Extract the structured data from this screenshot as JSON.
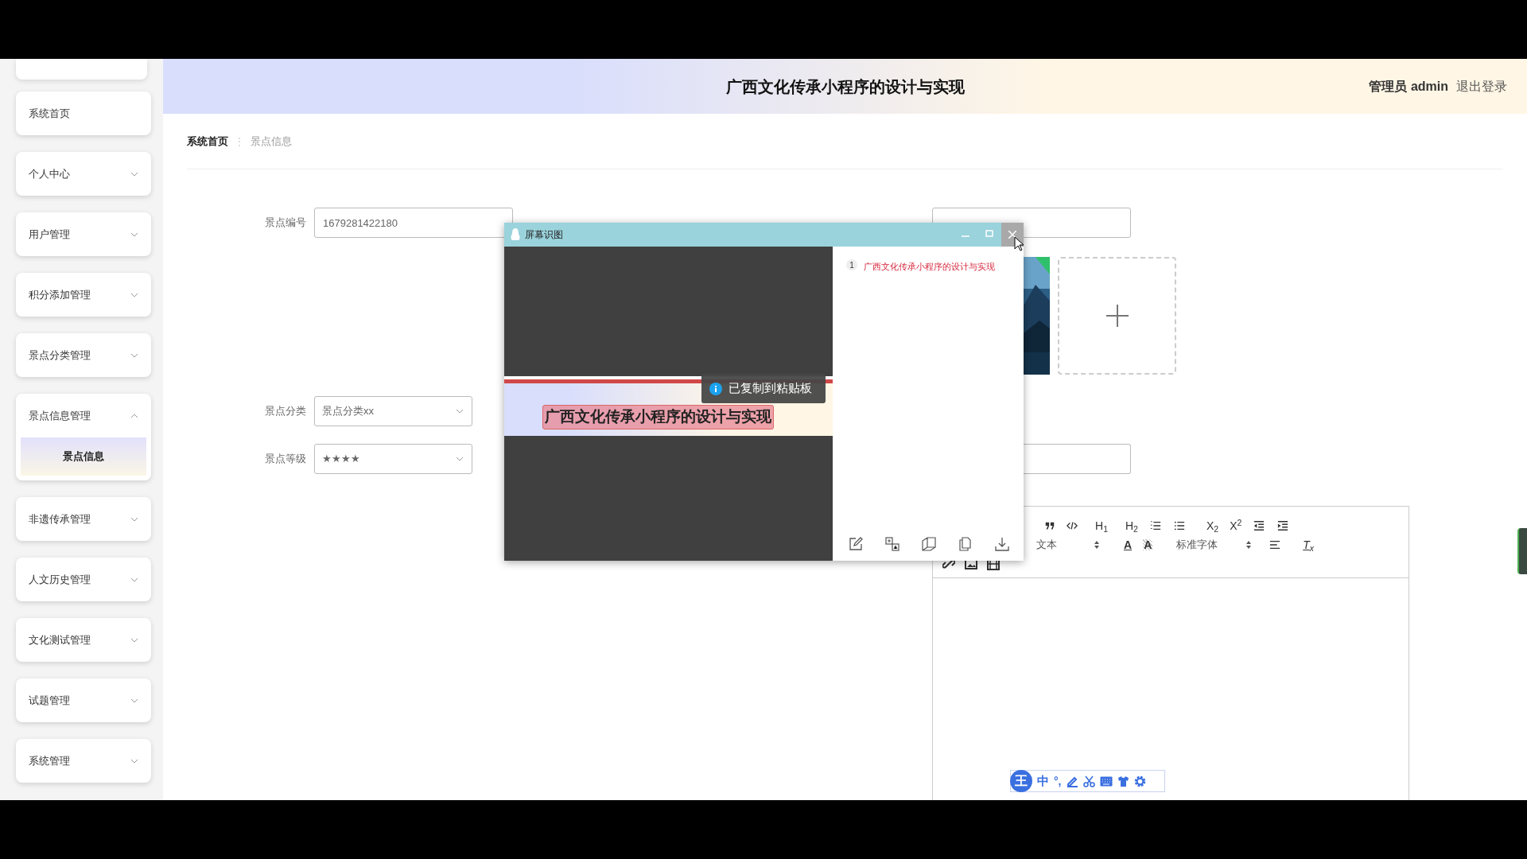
{
  "sidebar": {
    "items": [
      {
        "label": "系统首页",
        "kind": "link"
      },
      {
        "label": "个人中心",
        "kind": "menu",
        "expanded": false
      },
      {
        "label": "用户管理",
        "kind": "menu",
        "expanded": false
      },
      {
        "label": "积分添加管理",
        "kind": "menu",
        "expanded": false
      },
      {
        "label": "景点分类管理",
        "kind": "menu",
        "expanded": false
      },
      {
        "label": "景点信息管理",
        "kind": "menu",
        "expanded": true,
        "children": [
          {
            "label": "景点信息",
            "selected": true
          }
        ]
      },
      {
        "label": "非遗传承管理",
        "kind": "menu",
        "expanded": false
      },
      {
        "label": "人文历史管理",
        "kind": "menu",
        "expanded": false
      },
      {
        "label": "文化测试管理",
        "kind": "menu",
        "expanded": false
      },
      {
        "label": "试题管理",
        "kind": "menu",
        "expanded": false
      },
      {
        "label": "系统管理",
        "kind": "menu",
        "expanded": false
      }
    ]
  },
  "header": {
    "title": "广西文化传承小程序的设计与实现",
    "user": "管理员 admin",
    "logout": "退出登录"
  },
  "breadcrumb": {
    "separator": "⋮",
    "items": [
      {
        "label": "系统首页",
        "current": false
      },
      {
        "label": "景点信息",
        "current": true
      }
    ]
  },
  "form": {
    "fields": [
      {
        "label": "景点编号",
        "kind": "input",
        "value": "1679281422180"
      },
      {
        "label": "景点分类",
        "kind": "select",
        "value": "景点分类xx"
      },
      {
        "label": "景点等级",
        "kind": "select",
        "value": "★★★★"
      }
    ]
  },
  "editor": {
    "heading_buttons": [
      "H$_{1}$",
      "H$_{2}$"
    ],
    "script_buttons": [
      "X$_{2}$",
      "X$^{2}$"
    ],
    "format_select": "文本",
    "font_color_button": "A",
    "highlight_button": "A",
    "font_select": "标准字体",
    "clear_format_button": "T$_{x}$"
  },
  "popup": {
    "title": "屏幕识图",
    "capture_text": "广西文化传承小程序的设计与实现",
    "results": [
      {
        "number": "1",
        "text": "广西文化传承小程序的设计与实现"
      }
    ],
    "toast": "已复制到粘贴板"
  },
  "ime": {
    "logo": "王",
    "mode": "中",
    "punct": "°,"
  }
}
